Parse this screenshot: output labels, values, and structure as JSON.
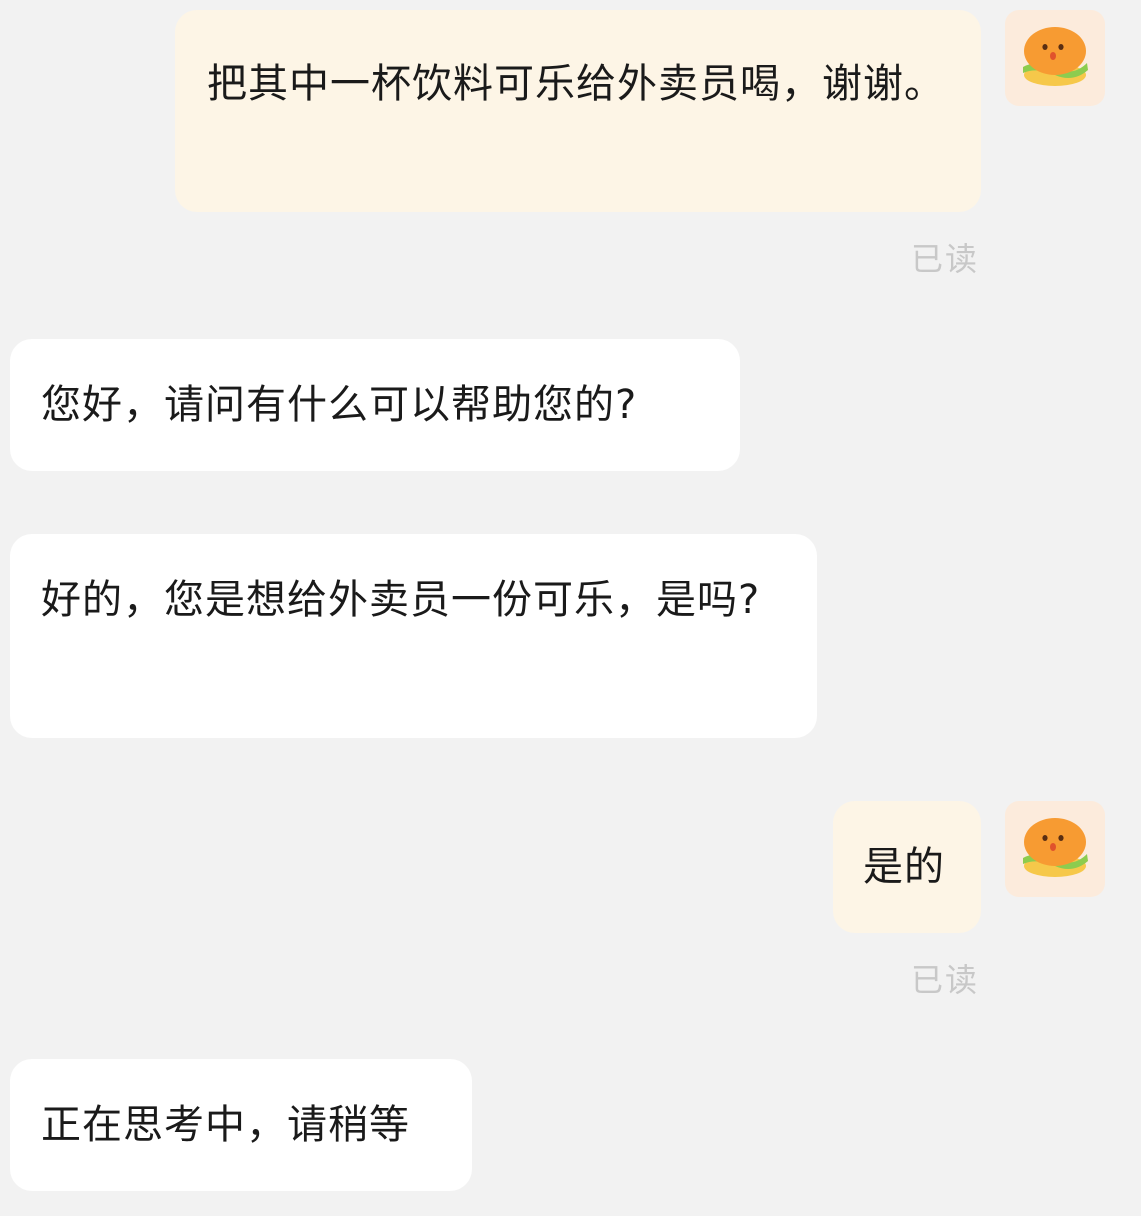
{
  "messages": [
    {
      "role": "user",
      "text": "把其中一杯饮料可乐给外卖员喝，谢谢。",
      "status": "已读"
    },
    {
      "role": "assistant",
      "text": "您好，请问有什么可以帮助您的?"
    },
    {
      "role": "assistant",
      "text": "好的，您是想给外卖员一份可乐，是吗?"
    },
    {
      "role": "user",
      "text": "是的",
      "status": "已读"
    },
    {
      "role": "assistant",
      "text": "正在思考中，请稍等"
    }
  ],
  "avatar": {
    "icon": "burger-mascot-icon"
  },
  "colors": {
    "background": "#f2f2f2",
    "user_bubble": "#fdf5e6",
    "assistant_bubble": "#ffffff",
    "read_status": "#c8c8c8",
    "avatar_bg": "#fcebdc"
  }
}
